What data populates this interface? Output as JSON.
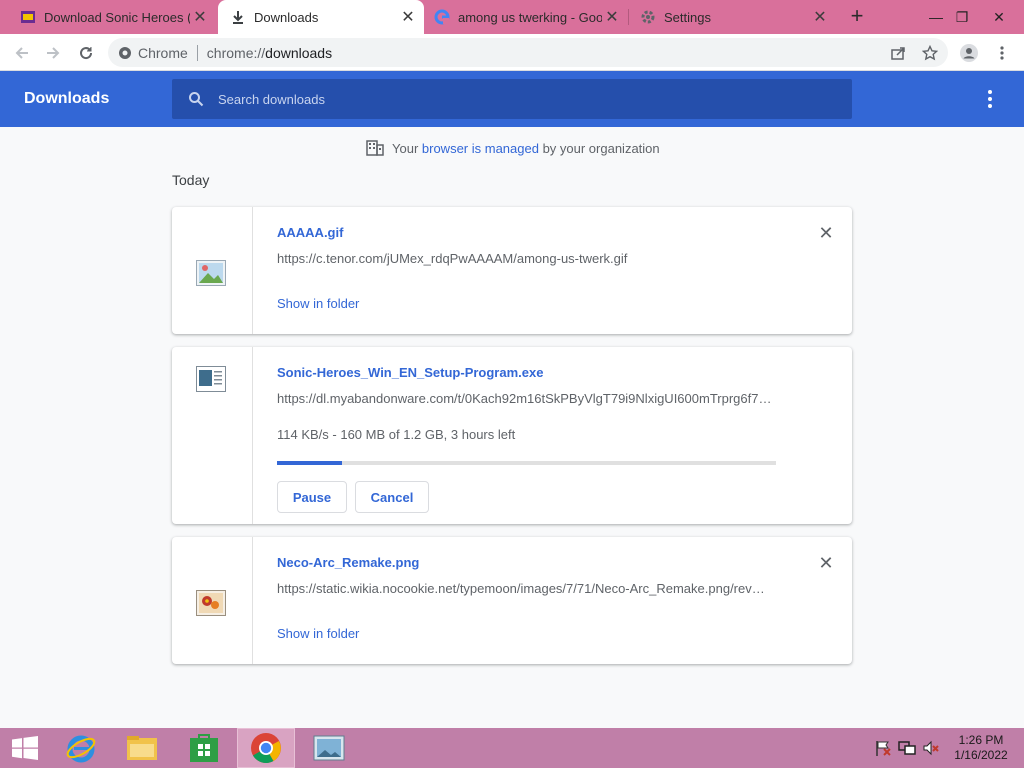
{
  "tabs": [
    {
      "title": "Download Sonic Heroes (W"
    },
    {
      "title": "Downloads"
    },
    {
      "title": "among us twerking - Goog"
    },
    {
      "title": "Settings"
    }
  ],
  "omnibox": {
    "site_label": "Chrome",
    "scheme": "chrome://",
    "host": "downloads"
  },
  "header": {
    "title": "Downloads",
    "search_placeholder": "Search downloads"
  },
  "managed": {
    "prefix": "Your ",
    "link": "browser is managed",
    "suffix": " by your organization"
  },
  "section_label": "Today",
  "downloads": [
    {
      "name": "AAAAA.gif",
      "url": "https://c.tenor.com/jUMex_rdqPwAAAAM/among-us-twerk.gif",
      "action": "Show in folder"
    },
    {
      "name": "Sonic-Heroes_Win_EN_Setup-Program.exe",
      "url": "https://dl.myabandonware.com/t/0Kach92m16tSkPByVlgT79i9NlxigUI600mTrprg6f7…",
      "status": "114 KB/s - 160 MB of 1.2 GB, 3 hours left",
      "progress_fraction": 0.13,
      "pause_label": "Pause",
      "cancel_label": "Cancel"
    },
    {
      "name": "Neco-Arc_Remake.png",
      "url": "https://static.wikia.nocookie.net/typemoon/images/7/71/Neco-Arc_Remake.png/rev…",
      "action": "Show in folder"
    }
  ],
  "clock": {
    "time": "1:26 PM",
    "date": "1/16/2022"
  },
  "colors": {
    "header_blue": "#3367d6",
    "tabstrip": "#d9709b",
    "taskbar": "#c07fa8"
  },
  "icons": [
    "back-icon",
    "forward-icon",
    "reload-icon",
    "share-icon",
    "star-icon",
    "profile-icon",
    "menu-icon",
    "search-icon",
    "building-icon",
    "close-icon",
    "download-icon",
    "google-icon",
    "gear-icon"
  ]
}
